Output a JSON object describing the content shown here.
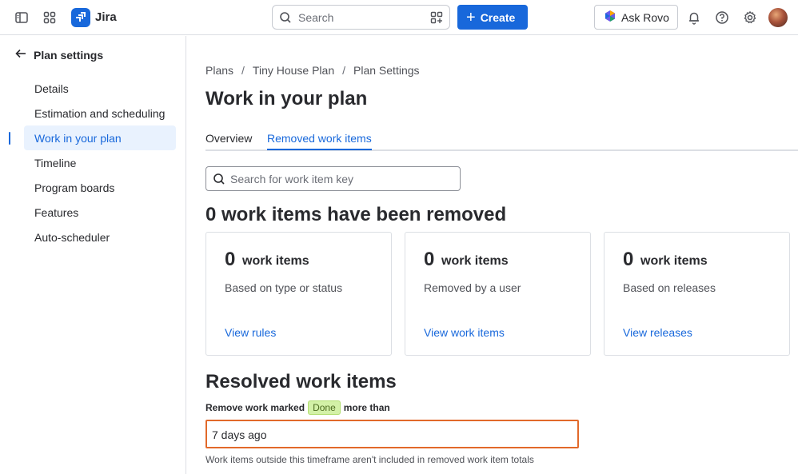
{
  "topbar": {
    "app_name": "Jira",
    "search_placeholder": "Search",
    "create_label": "Create",
    "ask_rovo_label": "Ask Rovo",
    "brand_color": "#1868db"
  },
  "sidebar": {
    "back_label": "Plan settings",
    "items": [
      {
        "label": "Details",
        "active": false
      },
      {
        "label": "Estimation and scheduling",
        "active": false
      },
      {
        "label": "Work in your plan",
        "active": true
      },
      {
        "label": "Timeline",
        "active": false
      },
      {
        "label": "Program boards",
        "active": false
      },
      {
        "label": "Features",
        "active": false
      },
      {
        "label": "Auto-scheduler",
        "active": false
      }
    ]
  },
  "breadcrumb": [
    "Plans",
    "Tiny House Plan",
    "Plan Settings"
  ],
  "page_title": "Work in your plan",
  "tabs": [
    {
      "label": "Overview",
      "active": false
    },
    {
      "label": "Removed work items",
      "active": true
    }
  ],
  "key_search_placeholder": "Search for work item key",
  "removed_heading": "0 work items have been removed",
  "cards": [
    {
      "count": "0",
      "unit": "work items",
      "desc": "Based on type or status",
      "link": "View rules"
    },
    {
      "count": "0",
      "unit": "work items",
      "desc": "Removed by a user",
      "link": "View work items"
    },
    {
      "count": "0",
      "unit": "work items",
      "desc": "Based on releases",
      "link": "View releases"
    }
  ],
  "resolved": {
    "heading": "Resolved work items",
    "label_before": "Remove work marked",
    "status_lozenge": "Done",
    "label_after": "more than",
    "value": "7 days ago",
    "helper": "Work items outside this timeframe aren't included in removed work item totals",
    "highlight_color": "#e2692a"
  }
}
